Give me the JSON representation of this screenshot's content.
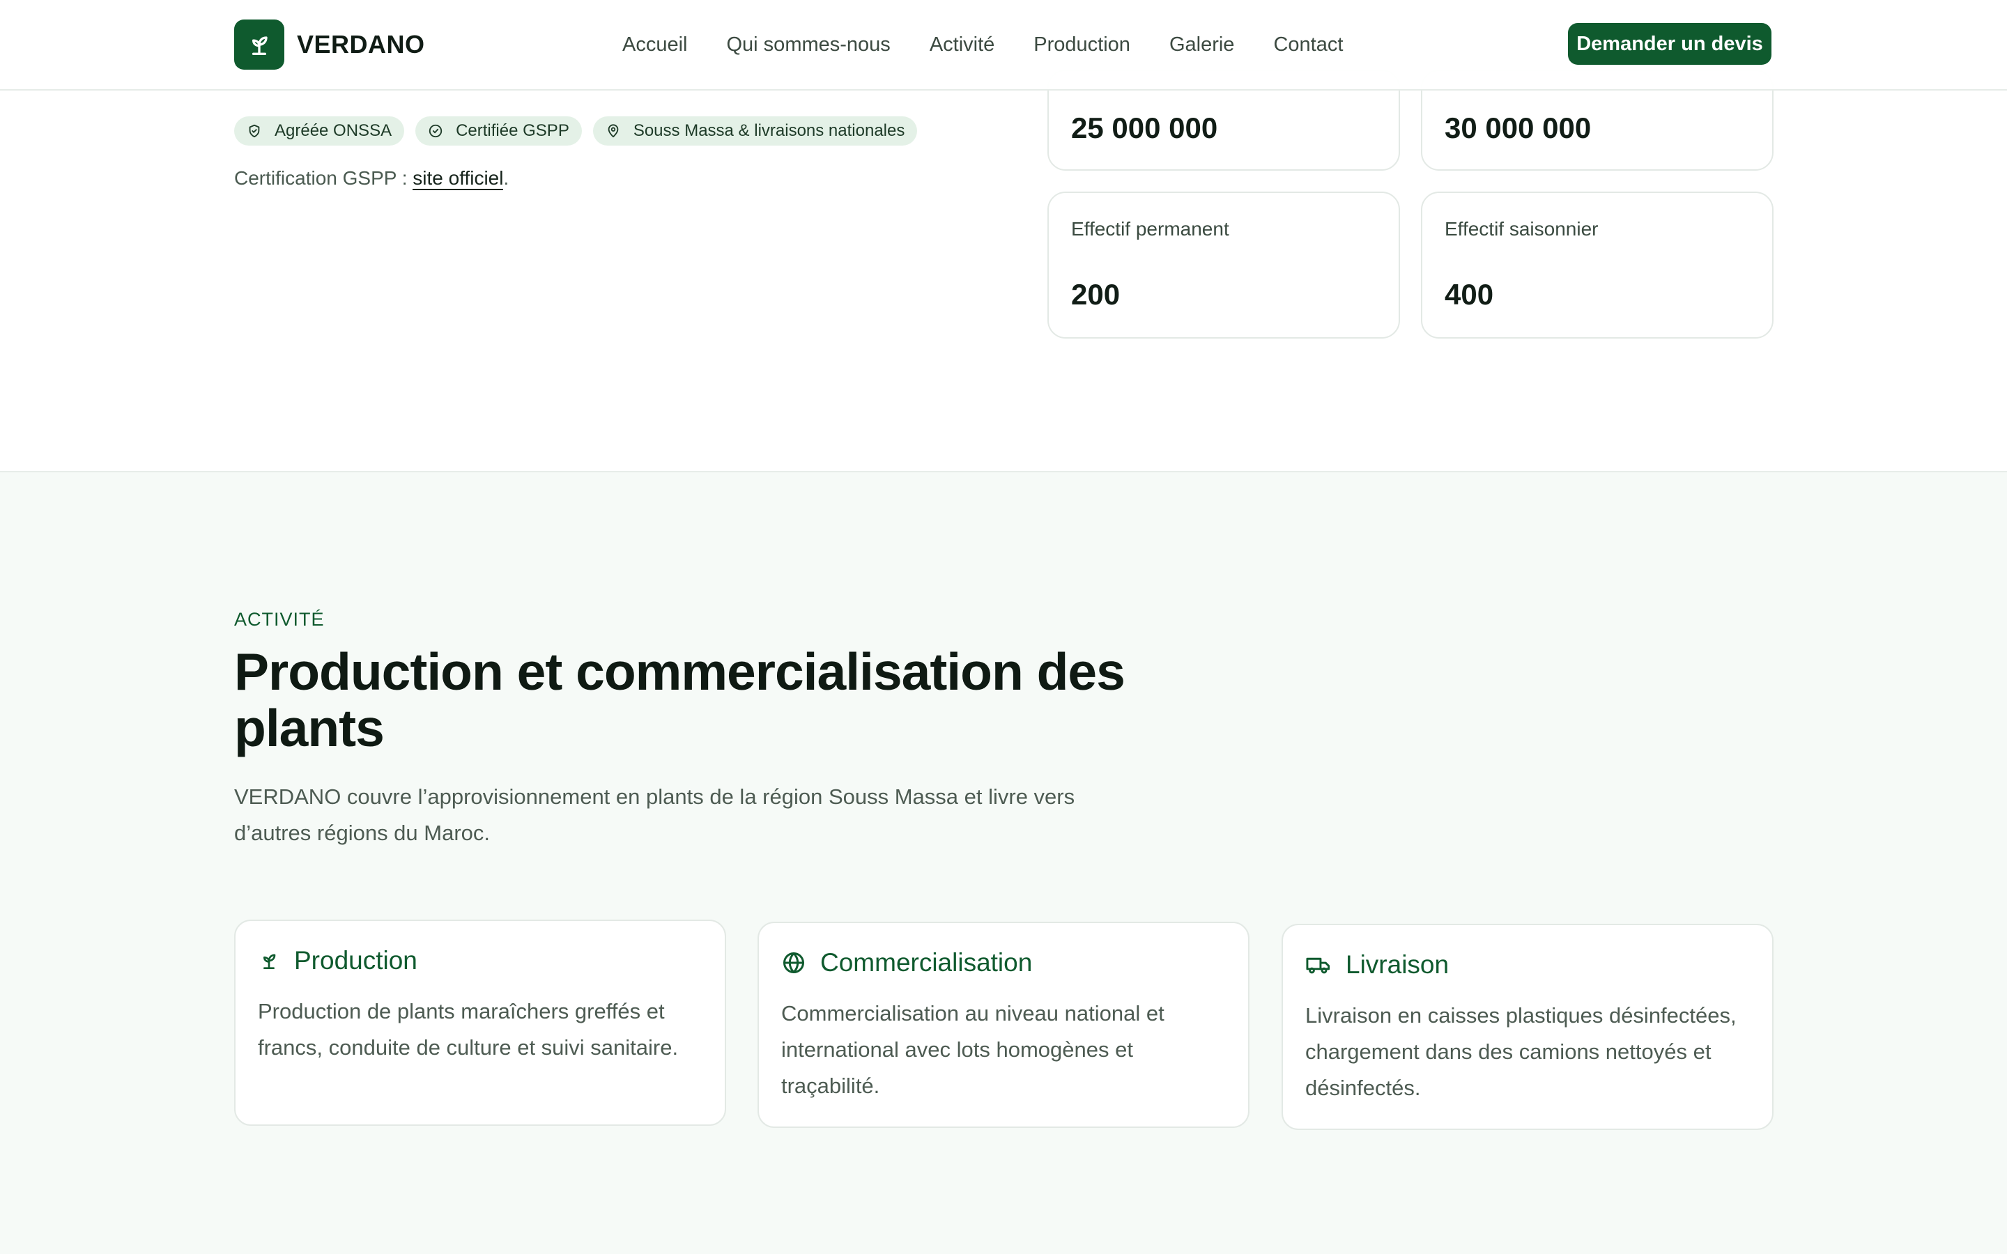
{
  "brand": {
    "name": "VERDANO",
    "logo_icon": "seedling-icon",
    "accent": "#0f5a2e"
  },
  "nav": {
    "items": [
      {
        "label": "Accueil"
      },
      {
        "label": "Qui sommes-nous"
      },
      {
        "label": "Activité"
      },
      {
        "label": "Production"
      },
      {
        "label": "Galerie"
      },
      {
        "label": "Contact"
      }
    ],
    "cta_label": "Demander un devis"
  },
  "hero": {
    "badges": [
      {
        "icon": "shield-check-icon",
        "label": "Agréée ONSSA"
      },
      {
        "icon": "check-circle-icon",
        "label": "Certifiée GSPP"
      },
      {
        "icon": "map-pin-icon",
        "label": "Souss Massa & livraisons nationales"
      }
    ],
    "cert_prefix": "Certification GSPP : ",
    "cert_link": "site officiel",
    "cert_suffix": "."
  },
  "stats": [
    {
      "label": "",
      "value": "25 000 000"
    },
    {
      "label": "",
      "value": "30 000 000"
    },
    {
      "label": "Effectif permanent",
      "value": "200"
    },
    {
      "label": "Effectif saisonnier",
      "value": "400"
    }
  ],
  "activity": {
    "eyebrow": "ACTIVITÉ",
    "title": "Production et commercialisation des plants",
    "description": "VERDANO couvre l’approvisionnement en plants de la région Souss Massa et livre vers d’autres régions du Maroc.",
    "features": [
      {
        "icon": "seedling-icon",
        "title": "Production",
        "text": "Production de plants maraîchers greffés et francs, conduite de culture et suivi sanitaire."
      },
      {
        "icon": "globe-icon",
        "title": "Commercialisation",
        "text": "Commercialisation au niveau national et international avec lots homogènes et traçabilité."
      },
      {
        "icon": "truck-icon",
        "title": "Livraison",
        "text": "Livraison en caisses plastiques désinfectées, chargement dans des camions nettoyés et désinfectés."
      }
    ]
  }
}
